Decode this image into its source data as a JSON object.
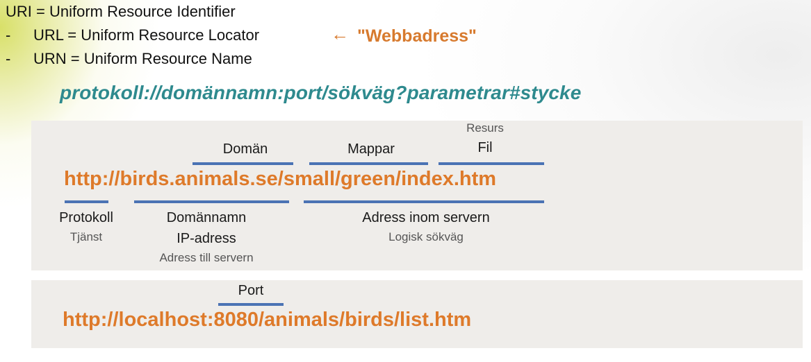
{
  "definitions": {
    "uri": "URI = Uniform Resource Identifier",
    "dash": "-",
    "url": "URL = Uniform Resource Locator",
    "urn": "URN = Uniform Resource Name",
    "arrow": "←",
    "webbadress": "\"Webbadress\""
  },
  "pattern": "protokoll://domännamn:port/sökväg?parametrar#stycke",
  "example1": {
    "url": "http://birds.animals.se/small/green/index.htm",
    "top_labels": {
      "doman": "Domän",
      "mappar": "Mappar",
      "resurs": "Resurs",
      "fil": "Fil"
    },
    "bottom_labels": {
      "protokoll": "Protokoll",
      "tjanst": "Tjänst",
      "domannamn": "Domännamn",
      "ip_adress": "IP-adress",
      "adress_till_servern": "Adress till servern",
      "adress_inom_servern": "Adress inom servern",
      "logisk_sokvag": "Logisk sökväg"
    }
  },
  "example2": {
    "url": "http://localhost:8080/animals/birds/list.htm",
    "port_label": "Port"
  },
  "colors": {
    "orange": "#de7a2a",
    "teal": "#2e8a8e",
    "blue_line": "#4b73b4",
    "panel": "#efedea"
  }
}
